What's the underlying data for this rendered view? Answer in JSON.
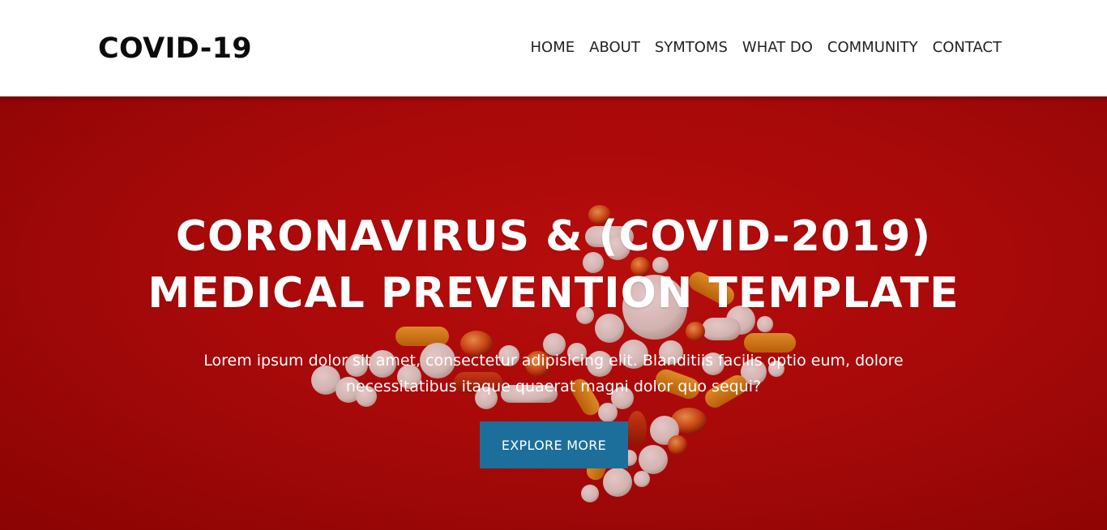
{
  "header": {
    "logo": "COVID-19",
    "nav": [
      {
        "label": "HOME"
      },
      {
        "label": "ABOUT"
      },
      {
        "label": "SYMTOMS"
      },
      {
        "label": "WHAT DO"
      },
      {
        "label": "COMMUNITY"
      },
      {
        "label": "CONTACT"
      }
    ]
  },
  "hero": {
    "title_line1": "CORONAVIRUS & (COVID-2019)",
    "title_line2": "MEDICAL PREVENTION TEMPLATE",
    "text_line1": "Lorem ipsum dolor sit amet, consectetur adipisicing elit. Blanditiis facilis optio eum, dolore",
    "text_line2": "necessitatibus itaque quaerat magni dolor quo sequi?",
    "button_label": "EXPLORE MORE"
  },
  "colors": {
    "hero_red": "#b30c0c",
    "button_blue": "#1b6f9a",
    "header_bg": "#ffffff",
    "logo_text": "#0c0c0c"
  }
}
